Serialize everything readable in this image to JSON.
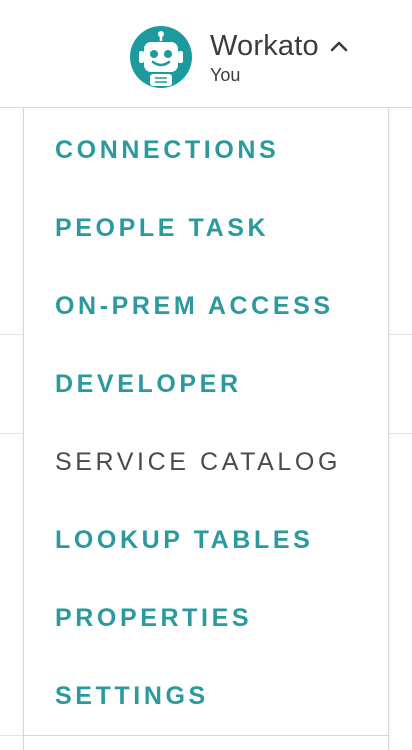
{
  "header": {
    "account_name": "Workato",
    "account_role": "You",
    "avatar_icon": "robot-icon",
    "chevron_icon": "chevron-up-icon"
  },
  "menu": {
    "items": [
      {
        "label": "CONNECTIONS"
      },
      {
        "label": "PEOPLE TASK"
      },
      {
        "label": "ON-PREM ACCESS"
      },
      {
        "label": "DEVELOPER"
      },
      {
        "label": "SERVICE CATALOG"
      },
      {
        "label": "LOOKUP TABLES"
      },
      {
        "label": "PROPERTIES"
      },
      {
        "label": "SETTINGS"
      }
    ],
    "highlighted_item": "SERVICE CATALOG"
  },
  "colors": {
    "accent": "#2a9a9e",
    "avatar_bg": "#1d9a9d",
    "text_dark": "#3c3c3c",
    "highlight_text": "#4a4a4a"
  }
}
